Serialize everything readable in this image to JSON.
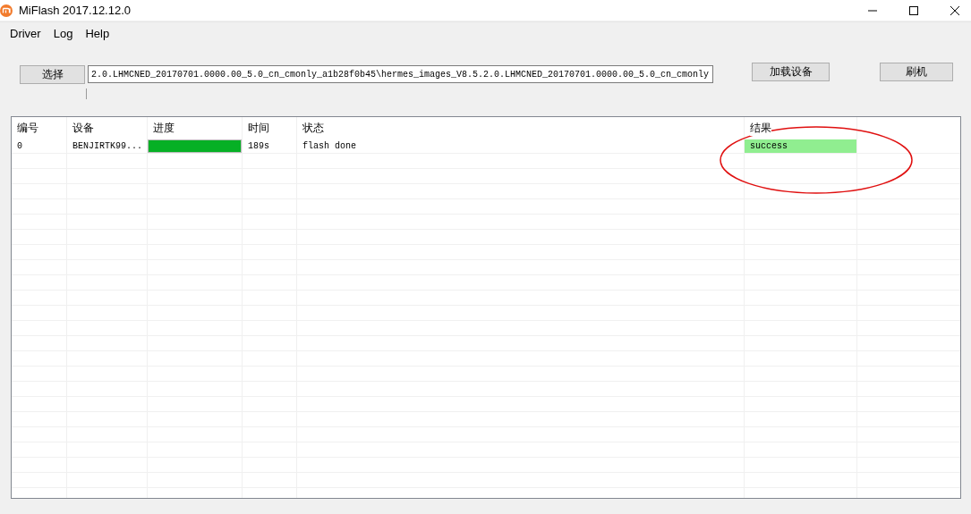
{
  "window": {
    "title": "MiFlash 2017.12.12.0"
  },
  "menu": [
    "Driver",
    "Log",
    "Help"
  ],
  "toolbar": {
    "select_button": "选择",
    "path": "2.0.LHMCNED_20170701.0000.00_5.0_cn_cmonly_a1b28f0b45\\hermes_images_V8.5.2.0.LHMCNED_20170701.0000.00_5.0_cn_cmonly",
    "load_button": "加载设备",
    "flash_button": "刷机"
  },
  "table": {
    "columns": [
      "编号",
      "设备",
      "进度",
      "时间",
      "状态",
      "结果"
    ],
    "rows": [
      {
        "id": "0",
        "device": "BENJIRTK99...",
        "level": 1,
        "time": "189s",
        "status": "flash done",
        "result": "success"
      }
    ]
  },
  "annotation": {
    "kind": "ellipse"
  }
}
